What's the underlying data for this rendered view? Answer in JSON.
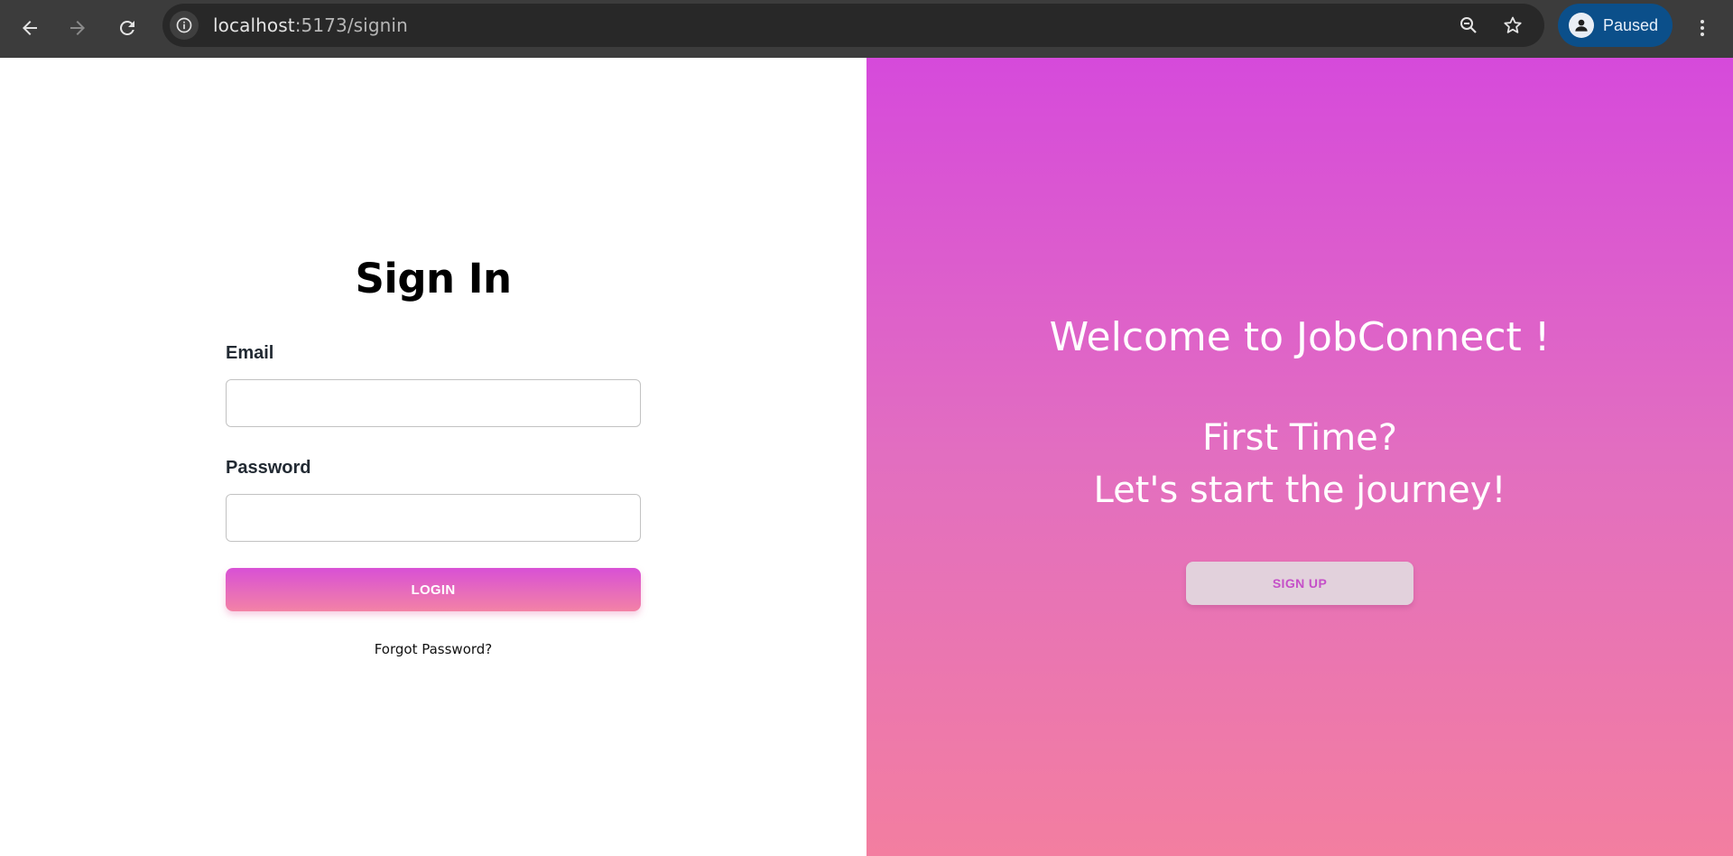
{
  "browser": {
    "url_host": "localhost",
    "url_path": ":5173/signin",
    "profile_label": "Paused",
    "icons": [
      "back-icon",
      "forward-icon",
      "reload-icon",
      "site-info-icon",
      "zoom-icon",
      "bookmark-star-icon",
      "profile-avatar-icon",
      "more-vert-icon"
    ]
  },
  "signin": {
    "title": "Sign In",
    "email_label": "Email",
    "email_value": "",
    "password_label": "Password",
    "password_value": "",
    "login_label": "LOGIN",
    "forgot_label": "Forgot Password?"
  },
  "promo": {
    "welcome": "Welcome to JobConnect !",
    "line1": "First Time?",
    "line2": "Let's start the journey!",
    "signup_label": "SIGN UP"
  },
  "colors": {
    "gradient_top": "#d64adb",
    "gradient_bottom": "#f37ea0",
    "chrome_bg": "#3c3c3c",
    "profile_bg": "#0b4f8a"
  }
}
